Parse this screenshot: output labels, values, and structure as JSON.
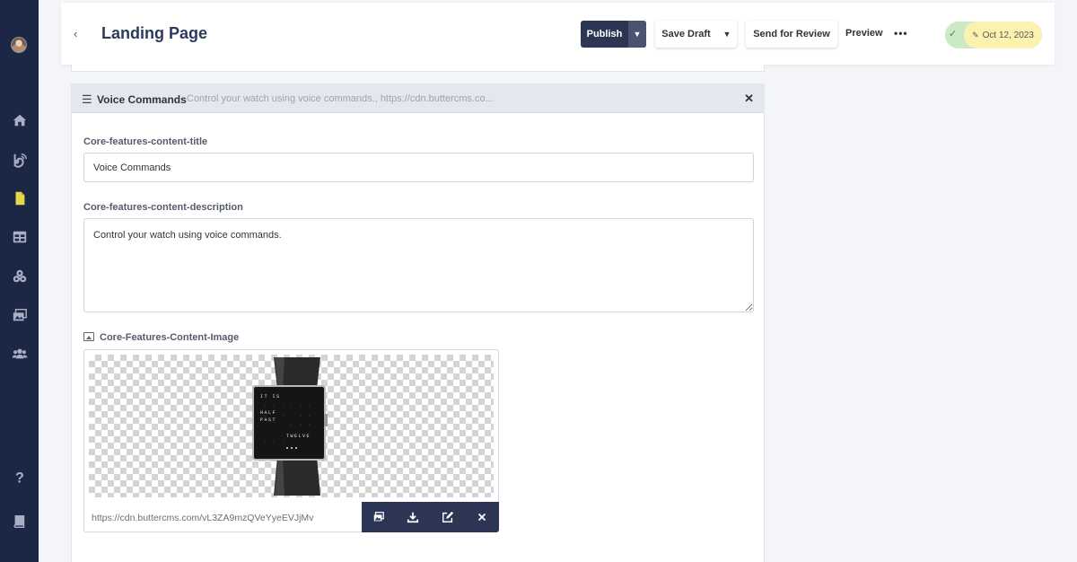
{
  "header": {
    "back": "‹",
    "title": "Landing Page",
    "publish_label": "Publish",
    "save_draft_label": "Save Draft",
    "send_review_label": "Send for Review",
    "preview_label": "Preview",
    "more_label": "•••",
    "status_check": "✓",
    "date": "Oct 12, 2023"
  },
  "section": {
    "title": "Voice Commands",
    "summary": "Control your watch using voice commands., https://cdn.buttercms.co...",
    "close": "✕"
  },
  "fields": {
    "title_label": "Core-features-content-title",
    "title_value": "Voice Commands",
    "description_label": "Core-features-content-description",
    "description_value": "Control your watch using voice commands.",
    "image_label": "Core-Features-Content-Image",
    "image_url": "https://cdn.buttercms.com/vL3ZA9mzQVeYyeEVJjMv"
  },
  "watch_face": {
    "line1": "IT IS",
    "line2": "HALF",
    "line3": "PAST",
    "line4": "TWELVE"
  },
  "colors": {
    "sidebar": "#1c2645",
    "primary_button": "#2c3654",
    "status_green": "#cbe9c4",
    "date_yellow": "#fbf2b0"
  }
}
